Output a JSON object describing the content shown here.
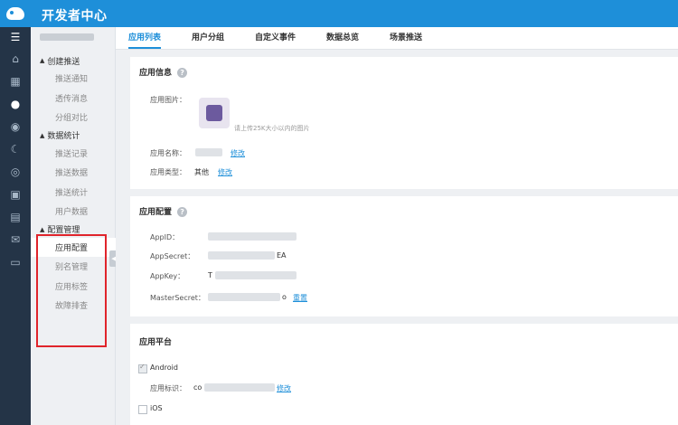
{
  "header": {
    "title": "开发者中心",
    "logo_icon": "whale-logo-icon"
  },
  "leftbar": {
    "icons": [
      "home-icon",
      "dashboard-icon",
      "push-icon",
      "eye-icon",
      "moon-icon",
      "fingerprint-icon",
      "phone-icon",
      "briefcase-icon",
      "mail-icon",
      "message-icon"
    ]
  },
  "sidebar": {
    "groups": [
      {
        "label": "创建推送",
        "items": [
          "推送通知",
          "透传消息",
          "分组对比"
        ]
      },
      {
        "label": "数据统计",
        "items": [
          "推送记录",
          "推送数据",
          "推送统计",
          "用户数据"
        ]
      },
      {
        "label": "配置管理",
        "items": [
          "应用配置",
          "别名管理",
          "应用标签",
          "故障排查"
        ]
      }
    ],
    "collapse_glyph": "◀"
  },
  "tabs": [
    "应用列表",
    "用户分组",
    "自定义事件",
    "数据总览",
    "场景推送"
  ],
  "app_info": {
    "title": "应用信息",
    "image_label": "应用图片：",
    "image_hint": "请上传25K大小以内的图片",
    "name_label": "应用名称：",
    "name_edit": "修改",
    "type_label": "应用类型：",
    "type_value": "其他",
    "type_edit": "修改"
  },
  "app_config": {
    "title": "应用配置",
    "appid_label": "AppID：",
    "appsecret_label": "AppSecret：",
    "appsecret_tail": "EA",
    "appkey_label": "AppKey：",
    "appkey_head": "T",
    "mastersecret_label": "MasterSecret：",
    "mastersecret_tail": "o",
    "reset": "重置"
  },
  "app_platform": {
    "title": "应用平台",
    "android_label": "Android",
    "android_checked": true,
    "id_label": "应用标识：",
    "id_head": "co",
    "id_edit": "修改",
    "ios_label": "iOS",
    "ios_checked": false
  },
  "colors": {
    "accent": "#1e8fd9",
    "highlight": "#e0242b",
    "leftbar": "#243447"
  }
}
